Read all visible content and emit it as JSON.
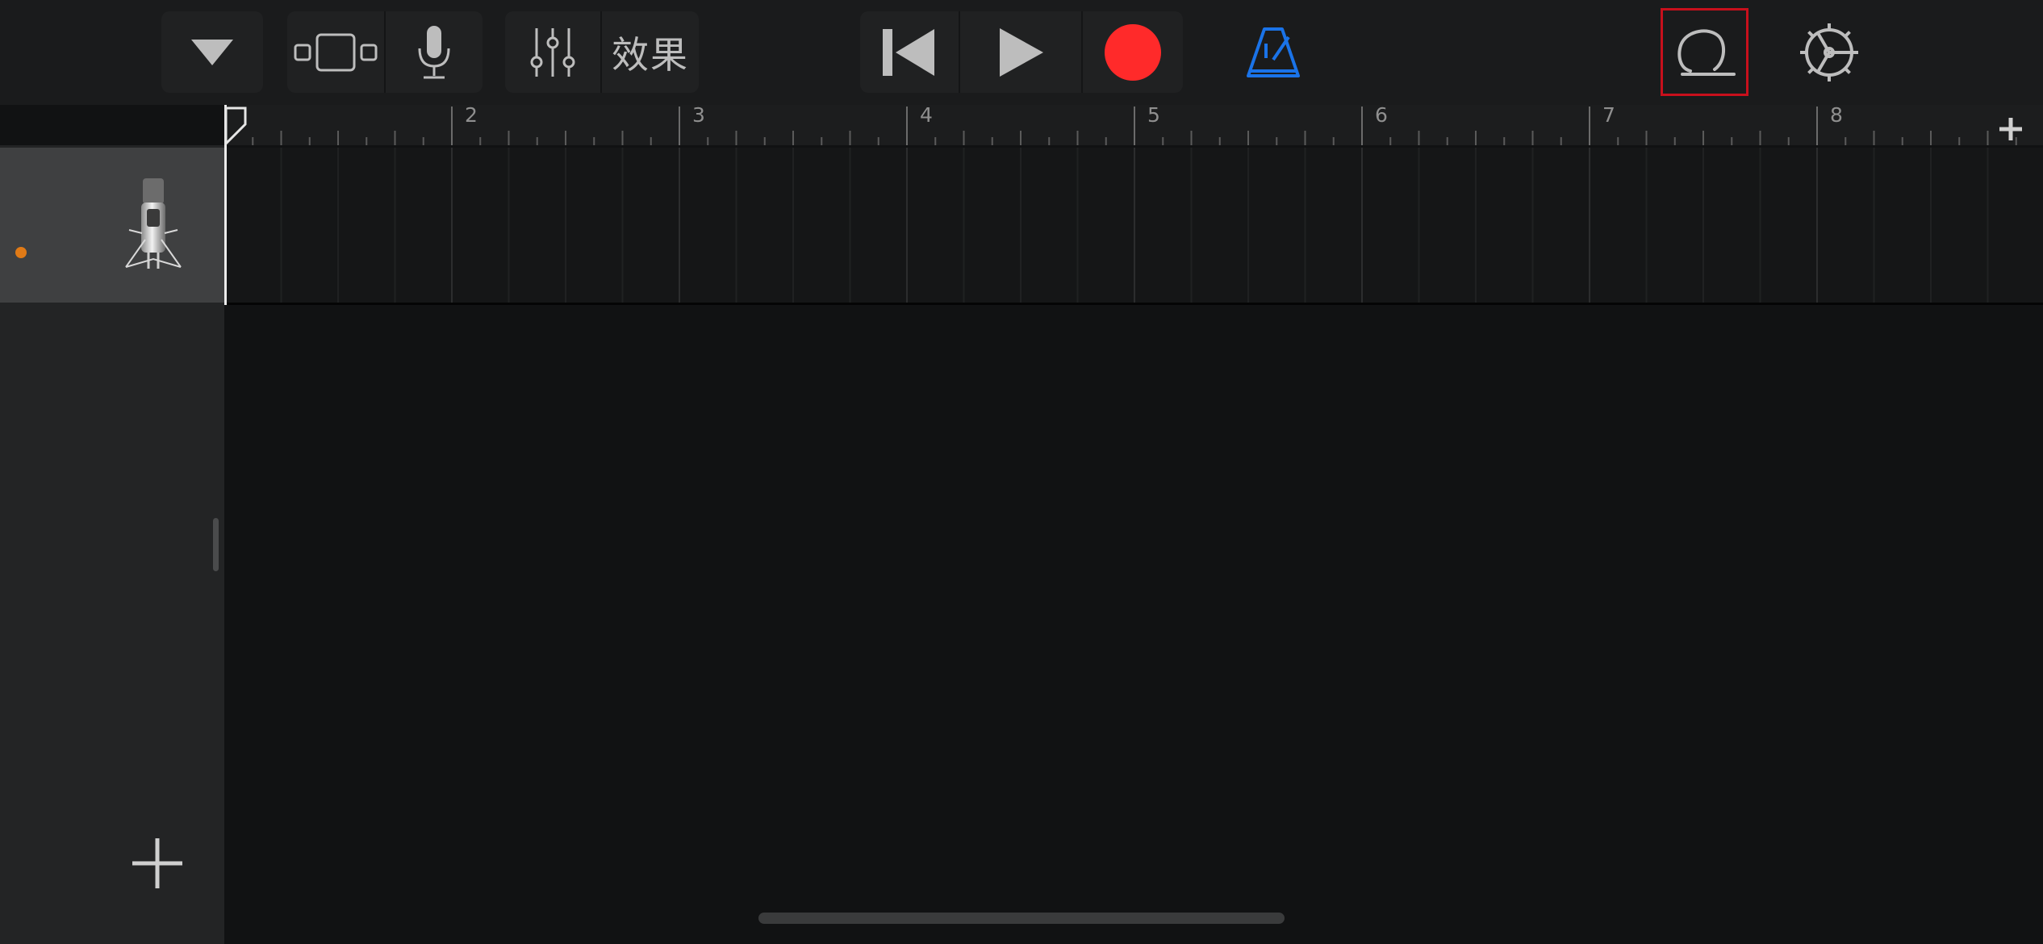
{
  "toolbar": {
    "browser_button": "browser",
    "view_toggle": "tracks-view",
    "mic_button": "input-settings",
    "mixer_button": "track-controls",
    "fx_label": "效果",
    "rewind_button": "go-to-beginning",
    "play_button": "play",
    "record_button": "record",
    "metronome_button": "metronome",
    "loop_button": "loop-browser",
    "settings_button": "settings"
  },
  "colors": {
    "record": "#ff2a2a",
    "metronome": "#1a73e8",
    "loop_highlight": "#c8101c",
    "track_dot": "#e07a16"
  },
  "ruler": {
    "bars": [
      "2",
      "3",
      "4",
      "5",
      "6",
      "7",
      "8"
    ]
  },
  "tracks": [
    {
      "instrument_icon": "microphone-icon",
      "selected": true
    }
  ]
}
